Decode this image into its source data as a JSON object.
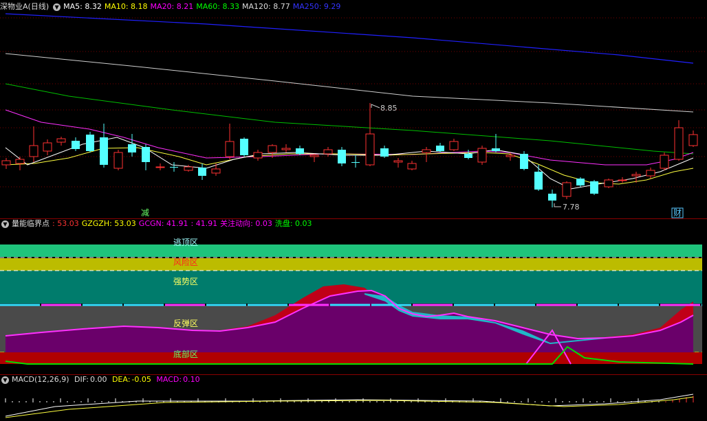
{
  "main": {
    "stock_name": "深物业A(日线)",
    "ma": [
      {
        "label": "MA5:",
        "value": "8.32",
        "color": "#ffffff"
      },
      {
        "label": "MA10:",
        "value": "8.18",
        "color": "#ffff00"
      },
      {
        "label": "MA20:",
        "value": "8.21",
        "color": "#ff00ff"
      },
      {
        "label": "MA60:",
        "value": "8.33",
        "color": "#00ff00"
      },
      {
        "label": "MA120:",
        "value": "8.77",
        "color": "#dddddd"
      },
      {
        "label": "MA250:",
        "value": "9.29",
        "color": "#3333ff"
      }
    ],
    "high_label": "8.85",
    "low_label": "7.78",
    "marker_left": "减",
    "marker_right": "财",
    "up_color": "#ff3232",
    "down_color": "#54ffff"
  },
  "indicator": {
    "name": "量能临界点",
    "values": [
      {
        "label": ":",
        "value": "53.03",
        "color": "#ff3232"
      },
      {
        "label": "GZGZH:",
        "value": "53.03",
        "color": "#ffff00"
      },
      {
        "label": "GCGN:",
        "value": "41.91",
        "color": "#ff00ff"
      },
      {
        "label": ":",
        "value": "41.91",
        "color": "#ff00ff"
      },
      {
        "label": "关注动向:",
        "value": "0.03",
        "color": "#ff00ff"
      },
      {
        "label": "洗盘:",
        "value": "0.03",
        "color": "#00ff00"
      }
    ],
    "zones": [
      "逃顶区",
      "风险区",
      "强势区",
      "反弹区",
      "底部区"
    ]
  },
  "macd": {
    "name": "MACD(12,26,9)",
    "dif": {
      "label": "DIF:",
      "value": "0.00"
    },
    "dea": {
      "label": "DEA:",
      "value": "-0.05"
    },
    "macd": {
      "label": "MACD:",
      "value": "0.10"
    }
  }
}
